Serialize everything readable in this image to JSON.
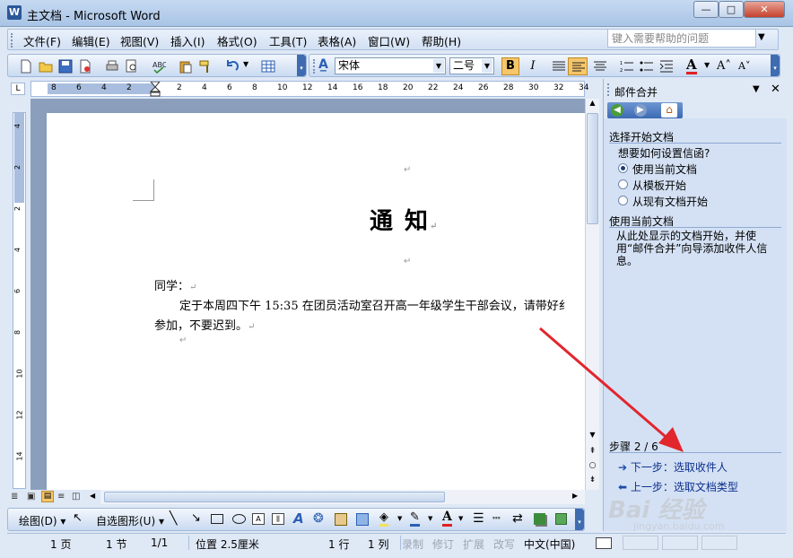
{
  "window": {
    "title": "主文档 - Microsoft Word",
    "app_icon": "W",
    "min_label": "—",
    "max_label": "□",
    "close_label": "✕"
  },
  "menu": {
    "items": [
      "文件(F)",
      "编辑(E)",
      "视图(V)",
      "插入(I)",
      "格式(O)",
      "工具(T)",
      "表格(A)",
      "窗口(W)",
      "帮助(H)"
    ],
    "help_placeholder": "键入需要帮助的问题"
  },
  "format": {
    "font_name": "宋体",
    "font_size": "二号",
    "bold_active": true,
    "italic_label": "I",
    "bold_label": "B",
    "font_color_label": "A",
    "grow_label": "A˄",
    "shrink_label": "A˅"
  },
  "ruler": {
    "left_ticks": [
      "8",
      "6",
      "4",
      "2"
    ],
    "right_ticks": [
      "2",
      "4",
      "6",
      "8",
      "10",
      "12",
      "14",
      "16",
      "18",
      "20",
      "22",
      "24",
      "26",
      "28",
      "30",
      "32",
      "34"
    ],
    "vertical_ticks": [
      "4",
      "2",
      "2",
      "4",
      "6",
      "8",
      "10",
      "12",
      "14"
    ]
  },
  "document": {
    "mark": "↵",
    "title": "通  知",
    "salutation": "同学：",
    "body_line1": "定于本周四下午 15:35 在团员活动室召开高一年级学生干部会议，请带好纟",
    "body_line2": "参加，不要迟到。"
  },
  "taskpane": {
    "title": "邮件合并",
    "section1": "选择开始文档",
    "question": "想要如何设置信函?",
    "options": [
      {
        "label": "使用当前文档",
        "selected": true
      },
      {
        "label": "从模板开始",
        "selected": false
      },
      {
        "label": "从现有文档开始",
        "selected": false
      }
    ],
    "section2": "使用当前文档",
    "description": "从此处显示的文档开始，并使用“邮件合并”向导添加收件人信息。",
    "step": "步骤 2 / 6",
    "next": "下一步：选取收件人",
    "prev": "上一步：选取文档类型"
  },
  "drawbar": {
    "draw_label": "绘图(D)",
    "autoshape_label": "自选图形(U)"
  },
  "status": {
    "page": "1 页",
    "section": "1 节",
    "pages": "1/1",
    "position": "位置 2.5厘米",
    "line": "1 行",
    "col": "1 列",
    "rec": "录制",
    "trk": "修订",
    "ext": "扩展",
    "ovr": "改写",
    "lang": "中文(中国)"
  },
  "watermark": {
    "brand": "Bai 经验",
    "url": "jingyan.baidu.com"
  },
  "colors": {
    "annotation_arrow": "#e2262e",
    "link": "#0c2f8d",
    "bold_highlight": "#f6c66b"
  }
}
